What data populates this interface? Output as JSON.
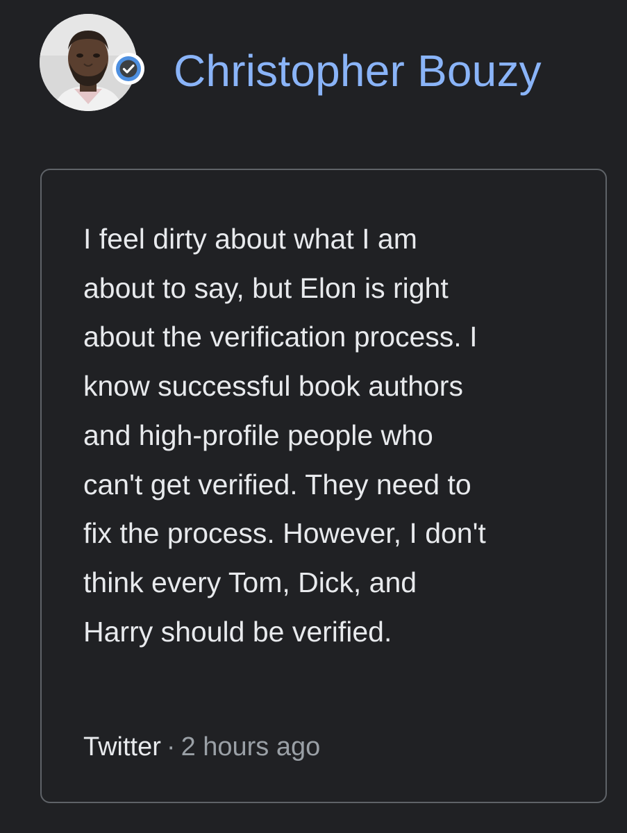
{
  "author": {
    "name": "Christopher Bouzy",
    "avatar_icon": "person-photo",
    "verified_icon": "verified-check-icon"
  },
  "post": {
    "text_lines": [
      "I feel dirty about what I am",
      "about to say, but Elon is right",
      "about the verification process. I",
      "know successful book authors",
      "and high-profile people who",
      "can't get verified. They need to",
      "fix the process. However, I don't",
      "think every Tom, Dick, and",
      "Harry should be verified."
    ],
    "source": "Twitter",
    "separator": "·",
    "time_ago": "2 hours ago"
  },
  "colors": {
    "background": "#202124",
    "name": "#8ab4f8",
    "text": "#e8eaed",
    "muted": "#9aa0a6",
    "border": "#5f6368",
    "badge": "#4d8fe0"
  }
}
